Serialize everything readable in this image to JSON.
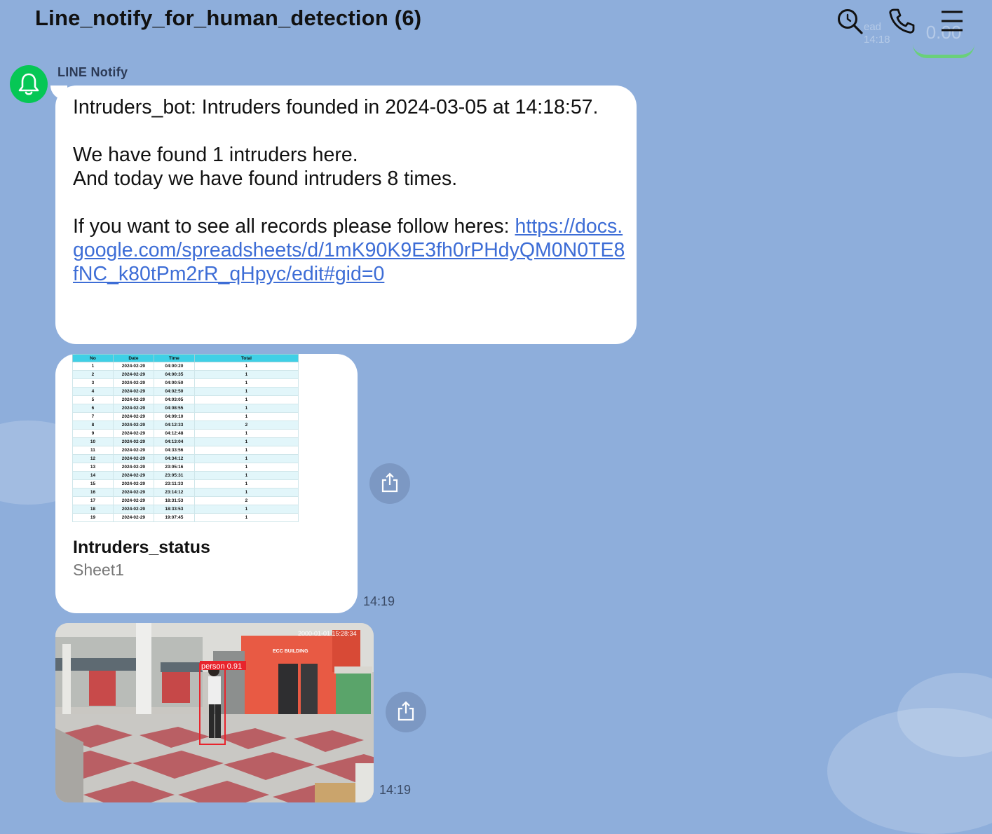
{
  "header": {
    "title": "Line_notify_for_human_detection (6)",
    "ghost_small": "ead\n14:18",
    "ghost_pill": "0.00"
  },
  "message1": {
    "sender": "LINE Notify",
    "line1": "Intruders_bot: Intruders founded in 2024-03-05 at 14:18:57.",
    "line2": "We have found 1 intruders here.",
    "line3": "And today we have found intruders 8 times.",
    "line4_prefix": "If you want to see all records please follow heres: ",
    "link": "https://docs.google.com/spreadsheets/d/1mK90K9E3fh0rPHdyQM0N0TE8fNC_k80tPm2rR_qHpyc/edit#gid=0"
  },
  "card": {
    "title": "Intruders_status",
    "subtitle": "Sheet1",
    "time": "14:19",
    "table": {
      "headers": [
        "No",
        "Date",
        "Time",
        "Total"
      ],
      "rows": [
        [
          "1",
          "2024-02-29",
          "04:00:20",
          "1"
        ],
        [
          "2",
          "2024-02-29",
          "04:00:35",
          "1"
        ],
        [
          "3",
          "2024-02-29",
          "04:00:50",
          "1"
        ],
        [
          "4",
          "2024-02-29",
          "04:02:50",
          "1"
        ],
        [
          "5",
          "2024-02-29",
          "04:03:05",
          "1"
        ],
        [
          "6",
          "2024-02-29",
          "04:08:55",
          "1"
        ],
        [
          "7",
          "2024-02-29",
          "04:09:10",
          "1"
        ],
        [
          "8",
          "2024-02-29",
          "04:12:33",
          "2"
        ],
        [
          "9",
          "2024-02-29",
          "04:12:48",
          "1"
        ],
        [
          "10",
          "2024-02-29",
          "04:13:04",
          "1"
        ],
        [
          "11",
          "2024-02-29",
          "04:33:56",
          "1"
        ],
        [
          "12",
          "2024-02-29",
          "04:34:12",
          "1"
        ],
        [
          "13",
          "2024-02-29",
          "23:05:16",
          "1"
        ],
        [
          "14",
          "2024-02-29",
          "23:05:31",
          "1"
        ],
        [
          "15",
          "2024-02-29",
          "23:11:33",
          "1"
        ],
        [
          "16",
          "2024-02-29",
          "23:14:12",
          "1"
        ],
        [
          "17",
          "2024-02-29",
          "18:31:53",
          "2"
        ],
        [
          "18",
          "2024-02-29",
          "18:33:53",
          "1"
        ],
        [
          "19",
          "2024-02-29",
          "19:07:45",
          "1"
        ]
      ]
    }
  },
  "photo": {
    "time": "14:19",
    "overlay_timestamp": "2000-01-01 15:28:34",
    "building_sign": "ECC BUILDING",
    "detection_label": "person 0.91",
    "detection_confidence": 0.91
  },
  "colors": {
    "background": "#8eaedb",
    "line_green": "#06c755",
    "link": "#3d6dd6",
    "detection_box": "#e8242c"
  }
}
